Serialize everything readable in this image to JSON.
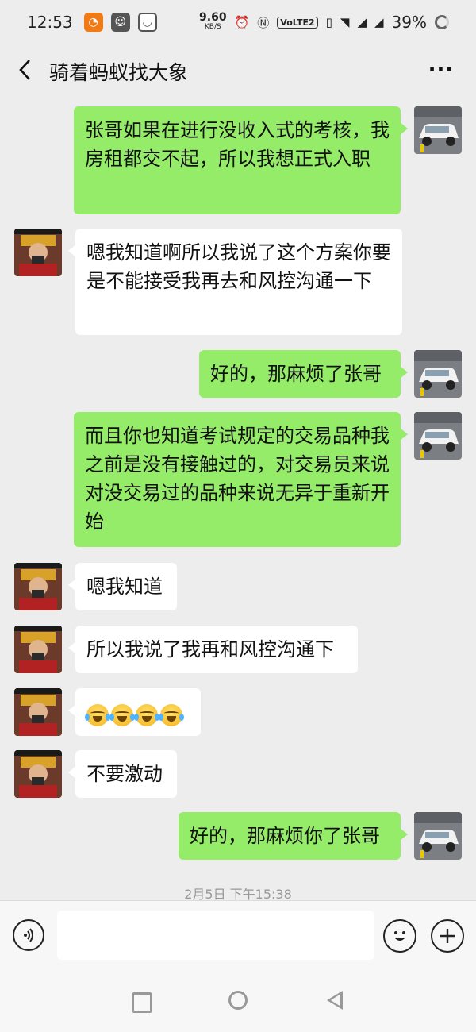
{
  "status_bar": {
    "time": "12:53",
    "net_speed": "9.60",
    "net_unit": "KB/S",
    "volte": "VoLTE2",
    "battery": "39%"
  },
  "header": {
    "title": "骑着蚂蚁找大象",
    "more": "···"
  },
  "messages": [
    {
      "from": "me",
      "text": "张哥如果在进行没收入式的考核，我房租都交不起，所以我想正式入职"
    },
    {
      "from": "them",
      "text": "嗯我知道啊所以我说了这个方案你要是不能接受我再去和风控沟通一下"
    },
    {
      "from": "me",
      "text": "好的，那麻烦了张哥"
    },
    {
      "from": "me",
      "text": "而且你也知道考试规定的交易品种我之前是没有接触过的，对交易员来说对没交易过的品种来说无异于重新开始"
    },
    {
      "from": "them",
      "text": "嗯我知道"
    },
    {
      "from": "them",
      "text": "所以我说了我再和风控沟通下"
    },
    {
      "from": "them",
      "emoji": [
        "laugh-cry",
        "laugh-cry",
        "laugh-cry",
        "laugh-cry"
      ]
    },
    {
      "from": "them",
      "text": "不要激动"
    },
    {
      "from": "me",
      "text": "好的，那麻烦你了张哥"
    }
  ],
  "timestamp": "2月5日 下午15:38",
  "input_bar": {
    "placeholder": ""
  },
  "colors": {
    "my_bubble": "#95ec69",
    "their_bubble": "#ffffff",
    "background": "#ededed"
  }
}
